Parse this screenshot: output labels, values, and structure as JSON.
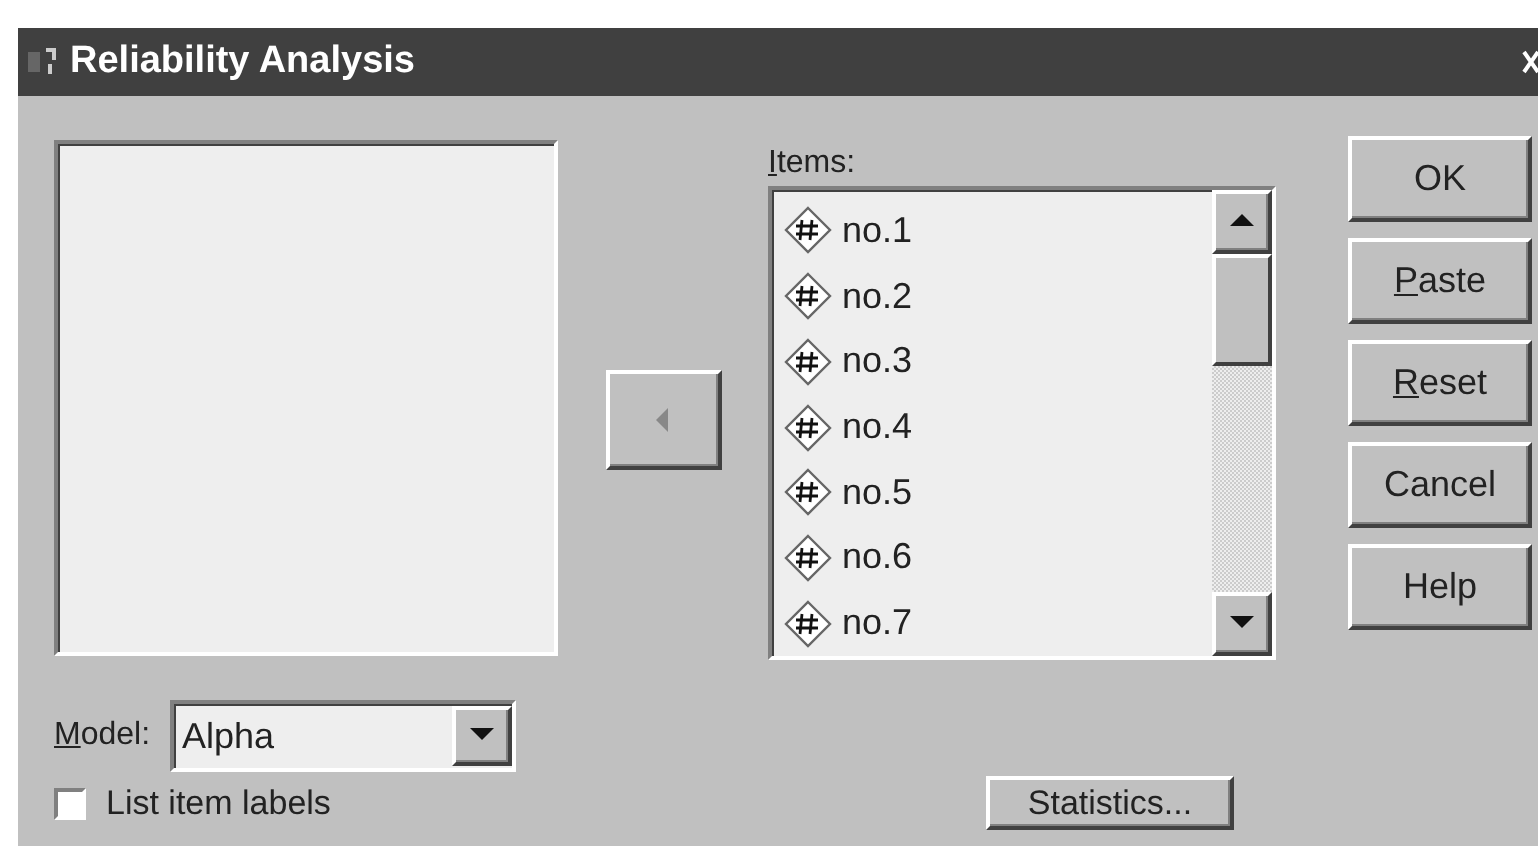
{
  "window": {
    "title": "Reliability Analysis"
  },
  "items_label": {
    "key": "I",
    "rest": "tems:"
  },
  "items": [
    {
      "label": "no.1",
      "selected": false
    },
    {
      "label": "no.2",
      "selected": false
    },
    {
      "label": "no.3",
      "selected": false
    },
    {
      "label": "no.4",
      "selected": false
    },
    {
      "label": "no.5",
      "selected": false
    },
    {
      "label": "no.6",
      "selected": false
    },
    {
      "label": "no.7",
      "selected": false
    }
  ],
  "move_button": {
    "disabled": true
  },
  "buttons": [
    {
      "rest": "OK"
    },
    {
      "key": "P",
      "rest": "aste"
    },
    {
      "key": "R",
      "rest": "eset"
    },
    {
      "rest": "Cancel"
    },
    {
      "rest": "Help"
    }
  ],
  "model": {
    "label": {
      "key": "M",
      "rest": "odel:"
    },
    "value": "Alpha"
  },
  "list_item_labels": {
    "label": "List item labels",
    "checked": false
  },
  "statistics_button": {
    "label": "Statistics..."
  }
}
